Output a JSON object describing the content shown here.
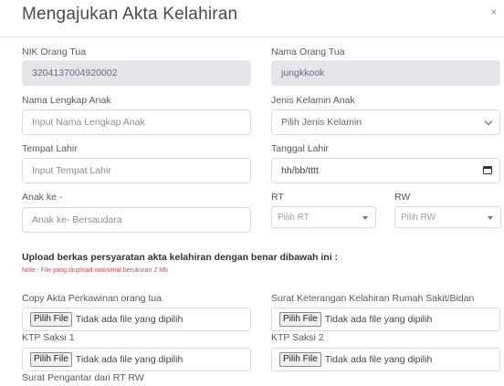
{
  "modal": {
    "title": "Mengajukan Akta Kelahiran",
    "close": "×"
  },
  "nik_ortu": {
    "label": "NIK Orang Tua",
    "value": "3204137004920002"
  },
  "nama_ortu": {
    "label": "Nama Orang Tua",
    "value": "jungkkook"
  },
  "nama_anak": {
    "label": "Nama Lengkap Anak",
    "placeholder": "Input Nama Lengkap Anak"
  },
  "jenis_kelamin": {
    "label": "Jenis Kelamin Anak",
    "selected": "Pilih Jenis Kelamin",
    "icon": "chevron-down-icon"
  },
  "tempat_lahir": {
    "label": "Tempat Lahir",
    "placeholder": "Input Tempat Lahir"
  },
  "tanggal_lahir": {
    "label": "Tanggal Lahir",
    "placeholder": "hh/bb/tttt",
    "icon": "calendar-icon"
  },
  "anak_ke": {
    "label": "Anak ke -",
    "placeholder": "Anak ke-  Bersaudara"
  },
  "rt": {
    "label": "RT",
    "selected": "Pilih RT"
  },
  "rw": {
    "label": "RW",
    "selected": "Pilih RW"
  },
  "upload": {
    "title": "Upload berkas persyaratan akta kelahiran dengan benar dibawah ini :",
    "note": "Note : File yang diupload maksimal berukuran 2 Mb",
    "button_label": "Pilih File",
    "no_file_text": "Tidak ada file yang dipilih",
    "akta_perkawinan_label": "Copy Akta Perkawinan orang tua",
    "surat_rs_label": "Surat Keterangan Kelahiran Rumah Sakit/Bidan",
    "saksi1_label": "KTP Saksi 1",
    "saksi2_label": "KTP Saksi 2",
    "pengantar_label": "Surat Pengantar dari RT RW"
  },
  "colors": {
    "note": "#e0454b",
    "readonly_bg": "#e3e5e8",
    "border": "#d8dbe0"
  }
}
